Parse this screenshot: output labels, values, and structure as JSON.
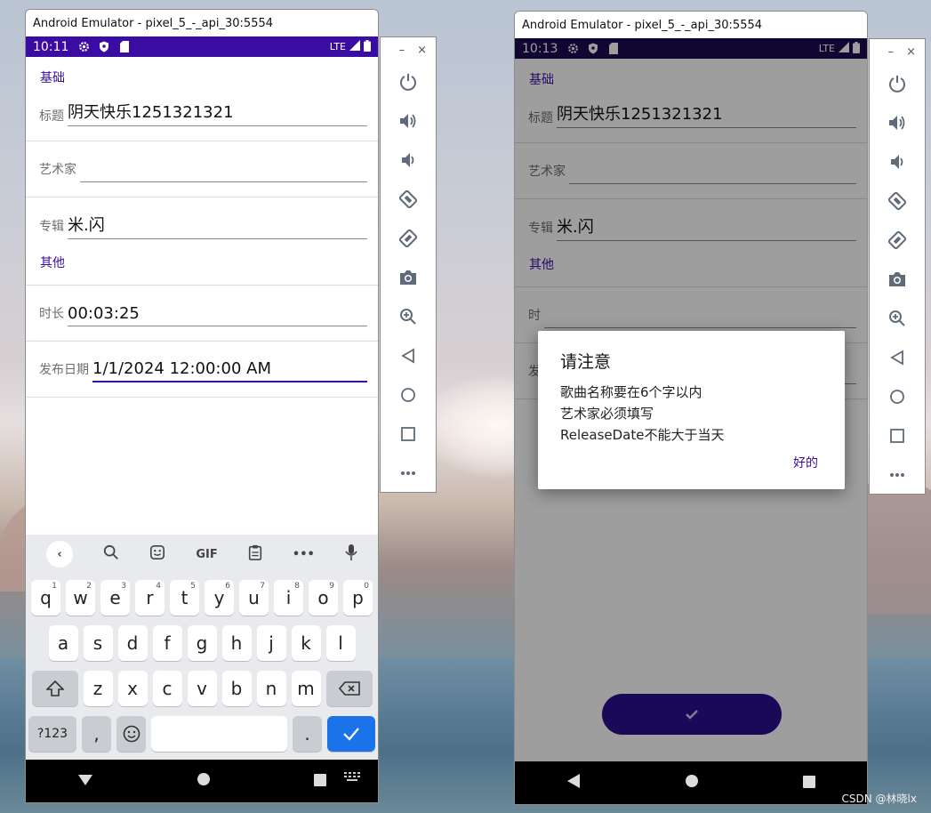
{
  "left": {
    "window_title": "Android Emulator - pixel_5_-_api_30:5554",
    "status": {
      "time": "10:11",
      "network": "LTE"
    },
    "sections": {
      "basic": "基础",
      "other": "其他"
    },
    "fields": {
      "title": {
        "label": "标题",
        "value": "阴天快乐1251321321"
      },
      "artist": {
        "label": "艺术家",
        "value": ""
      },
      "album": {
        "label": "专辑",
        "value": "米.闪"
      },
      "duration": {
        "label": "时长",
        "value": "00:03:25"
      },
      "release_date": {
        "label": "发布日期",
        "value": "1/1/2024 12:00:00 AM"
      }
    },
    "keyboard": {
      "toolbar": [
        "‹",
        "search",
        "sticker",
        "GIF",
        "clipboard",
        "•••",
        "mic"
      ],
      "row1": [
        {
          "k": "q",
          "n": "1"
        },
        {
          "k": "w",
          "n": "2"
        },
        {
          "k": "e",
          "n": "3"
        },
        {
          "k": "r",
          "n": "4"
        },
        {
          "k": "t",
          "n": "5"
        },
        {
          "k": "y",
          "n": "6"
        },
        {
          "k": "u",
          "n": "7"
        },
        {
          "k": "i",
          "n": "8"
        },
        {
          "k": "o",
          "n": "9"
        },
        {
          "k": "p",
          "n": "0"
        }
      ],
      "row2": [
        "a",
        "s",
        "d",
        "f",
        "g",
        "h",
        "j",
        "k",
        "l"
      ],
      "row3": [
        "z",
        "x",
        "c",
        "v",
        "b",
        "n",
        "m"
      ],
      "sym_label": "?123",
      "comma": ",",
      "period": "."
    }
  },
  "right": {
    "window_title": "Android Emulator - pixel_5_-_api_30:5554",
    "status": {
      "time": "10:13",
      "network": "LTE"
    },
    "sections": {
      "basic": "基础",
      "other": "其他"
    },
    "fields": {
      "title": {
        "label": "标题",
        "value": "阴天快乐1251321321"
      },
      "artist": {
        "label": "艺术家",
        "value": ""
      },
      "album": {
        "label": "专辑",
        "value": "米.闪"
      },
      "duration": {
        "label": "时",
        "value": ""
      },
      "release_date": {
        "label": "发",
        "value": ""
      }
    },
    "dialog": {
      "title": "请注意",
      "lines": [
        "歌曲名称要在6个字以内",
        "艺术家必须填写",
        "ReleaseDate不能大于当天"
      ],
      "ok_label": "好的"
    },
    "fab_icon": "check-icon"
  },
  "emulator_panel": {
    "minimize": "–",
    "close": "×",
    "buttons": [
      "power-icon",
      "volume-up-icon",
      "volume-down-icon",
      "rotate-left-icon",
      "rotate-right-icon",
      "camera-icon",
      "zoom-icon",
      "back-icon",
      "home-icon",
      "overview-icon",
      "more-icon"
    ]
  },
  "watermark": "CSDN @林晓lx",
  "colors": {
    "accent": "#3a0ca3",
    "statusbar_left": "#3a0ca3",
    "statusbar_right": "#1c0a52",
    "fab": "#2a0d8f"
  }
}
